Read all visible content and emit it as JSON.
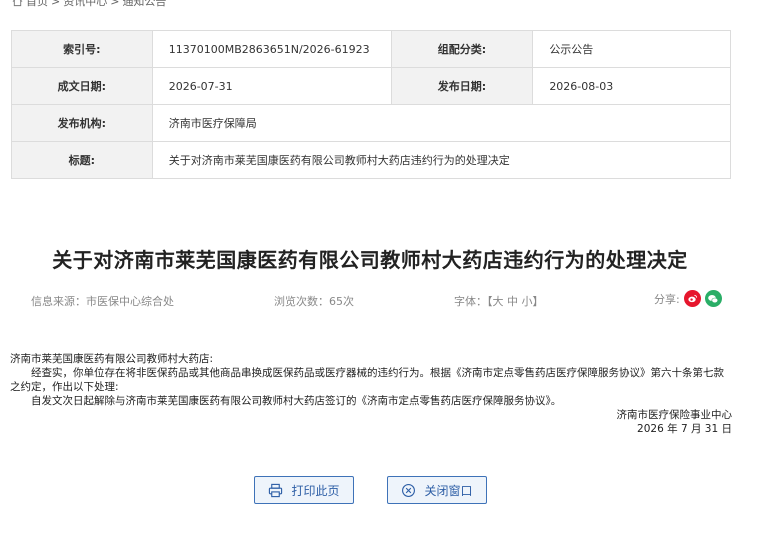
{
  "breadcrumb": {
    "home": "首页",
    "sep1": ">",
    "section": "资讯中心",
    "sep2": ">",
    "current": "通知公告"
  },
  "meta": {
    "index_label": "索引号:",
    "index_value": "11370100MB2863651N/2026-61923",
    "category_label": "组配分类:",
    "category_value": "公示公告",
    "created_label": "成文日期:",
    "created_value": "2026-07-31",
    "published_label": "发布日期:",
    "published_value": "2026-08-03",
    "org_label": "发布机构:",
    "org_value": "济南市医疗保障局",
    "subject_label": "标题:",
    "subject_value": "关于对济南市莱芜国康医药有限公司教师村大药店违约行为的处理决定"
  },
  "article": {
    "title": "关于对济南市莱芜国康医药有限公司教师村大药店违约行为的处理决定",
    "source": "信息来源：市医保中心综合处",
    "views": "浏览次数：65次",
    "font_size": "字体：【大  中  小】",
    "share_label": "分享:",
    "addressee": "济南市莱芜国康医药有限公司教师村大药店:",
    "para1": "经查实，你单位存在将非医保药品或其他商品串换成医保药品或医疗器械的违约行为。根据《济南市定点零售药店医疗保障服务协议》第六十条第七款之约定，作出以下处理:",
    "para2": "自发文次日起解除与济南市莱芜国康医药有限公司教师村大药店签订的《济南市定点零售药店医疗保障服务协议》。",
    "signature": "济南市医疗保险事业中心",
    "date": "2026 年 7 月 31 日"
  },
  "buttons": {
    "print": "打印此页",
    "close": "关闭窗口"
  },
  "colors": {
    "accent": "#2d5ea6",
    "weibo": "#e6162d",
    "wechat": "#2aae67"
  }
}
